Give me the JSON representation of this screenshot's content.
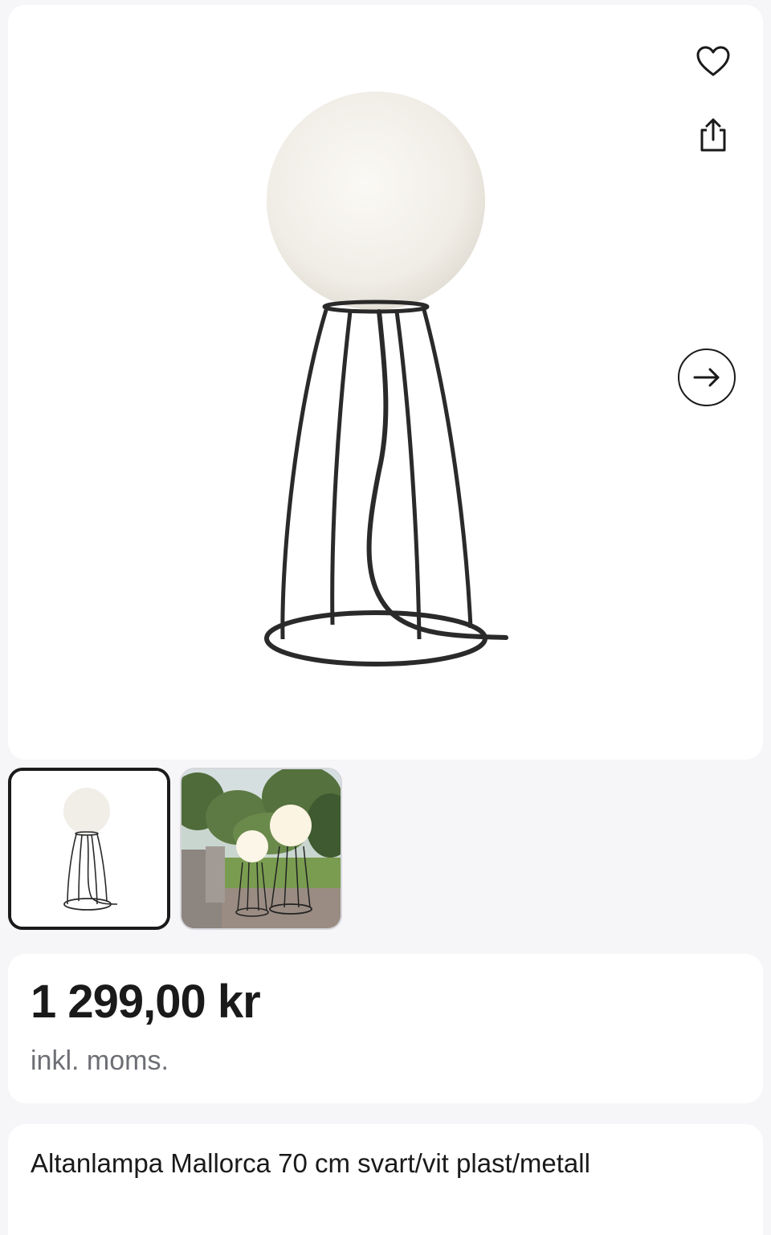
{
  "product": {
    "title": "Altanlampa Mallorca 70 cm svart/vit plast/metall",
    "price": "1 299,00 kr",
    "vat_note": "inkl. moms."
  },
  "gallery": {
    "thumbnails": [
      {
        "alt": "Mallorca lampa produktbild",
        "selected": true
      },
      {
        "alt": "Mallorca lampor i trädgård",
        "selected": false
      }
    ]
  },
  "icons": {
    "favorite": "heart-icon",
    "share": "share-icon",
    "next": "arrow-right-icon"
  },
  "colors": {
    "background": "#f6f6f9",
    "card": "#ffffff",
    "text": "#1a1a1a",
    "muted": "#6d6f75",
    "lamp_frame": "#2a2a2a",
    "lamp_globe": "#f3f0ea"
  }
}
